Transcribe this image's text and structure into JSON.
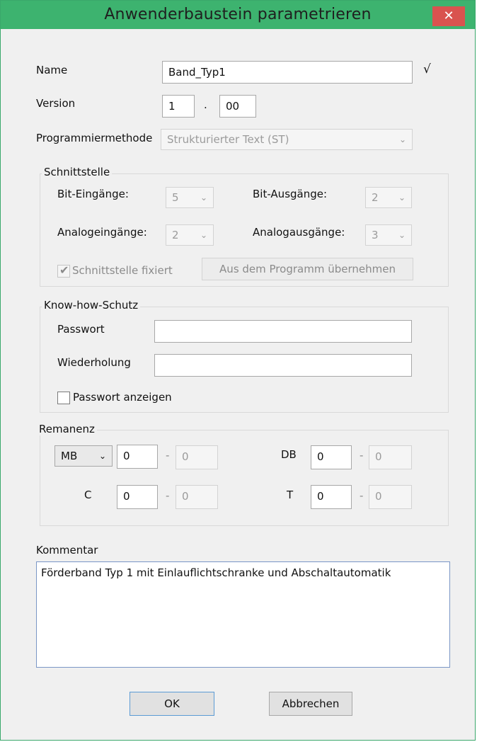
{
  "window": {
    "title": "Anwenderbaustein parametrieren",
    "close_glyph": "✕"
  },
  "fields": {
    "name_label": "Name",
    "name_value": "Band_Typ1",
    "name_valid_mark": "√",
    "version_label": "Version",
    "version_major": "1",
    "version_sep": ".",
    "version_minor": "00",
    "method_label": "Programmiermethode",
    "method_value": "Strukturierter Text (ST)"
  },
  "interface": {
    "group_label": "Schnittstelle",
    "bit_inputs_label": "Bit-Eingänge:",
    "bit_inputs_value": "5",
    "bit_outputs_label": "Bit-Ausgänge:",
    "bit_outputs_value": "2",
    "analog_inputs_label": "Analogeingänge:",
    "analog_inputs_value": "2",
    "analog_outputs_label": "Analogausgänge:",
    "analog_outputs_value": "3",
    "fixed_checkbox_label": "Schnittstelle fixiert",
    "fixed_checked": true,
    "take_from_program_button": "Aus dem Programm übernehmen"
  },
  "protection": {
    "group_label": "Know-how-Schutz",
    "password_label": "Passwort",
    "password_value": "",
    "repeat_label": "Wiederholung",
    "repeat_value": "",
    "show_password_label": "Passwort anzeigen",
    "show_password_checked": false
  },
  "retentive": {
    "group_label": "Remanenz",
    "mb_select": "MB",
    "mb_from": "0",
    "mb_to": "0",
    "db_label": "DB",
    "db_from": "0",
    "db_to": "0",
    "c_label": "C",
    "c_from": "0",
    "c_to": "0",
    "t_label": "T",
    "t_from": "0",
    "t_to": "0",
    "range_sep": "-"
  },
  "comment": {
    "label": "Kommentar",
    "value": "Förderband Typ 1 mit Einlauflichtschranke und Abschaltautomatik"
  },
  "buttons": {
    "ok": "OK",
    "cancel": "Abbrechen"
  },
  "icons": {
    "chevron": "chevron-down-icon",
    "close": "close-icon",
    "check": "checkmark-icon"
  },
  "colors": {
    "titlebar": "#3db36f",
    "close_button": "#d9534f",
    "dialog_bg": "#f0f0f0"
  }
}
